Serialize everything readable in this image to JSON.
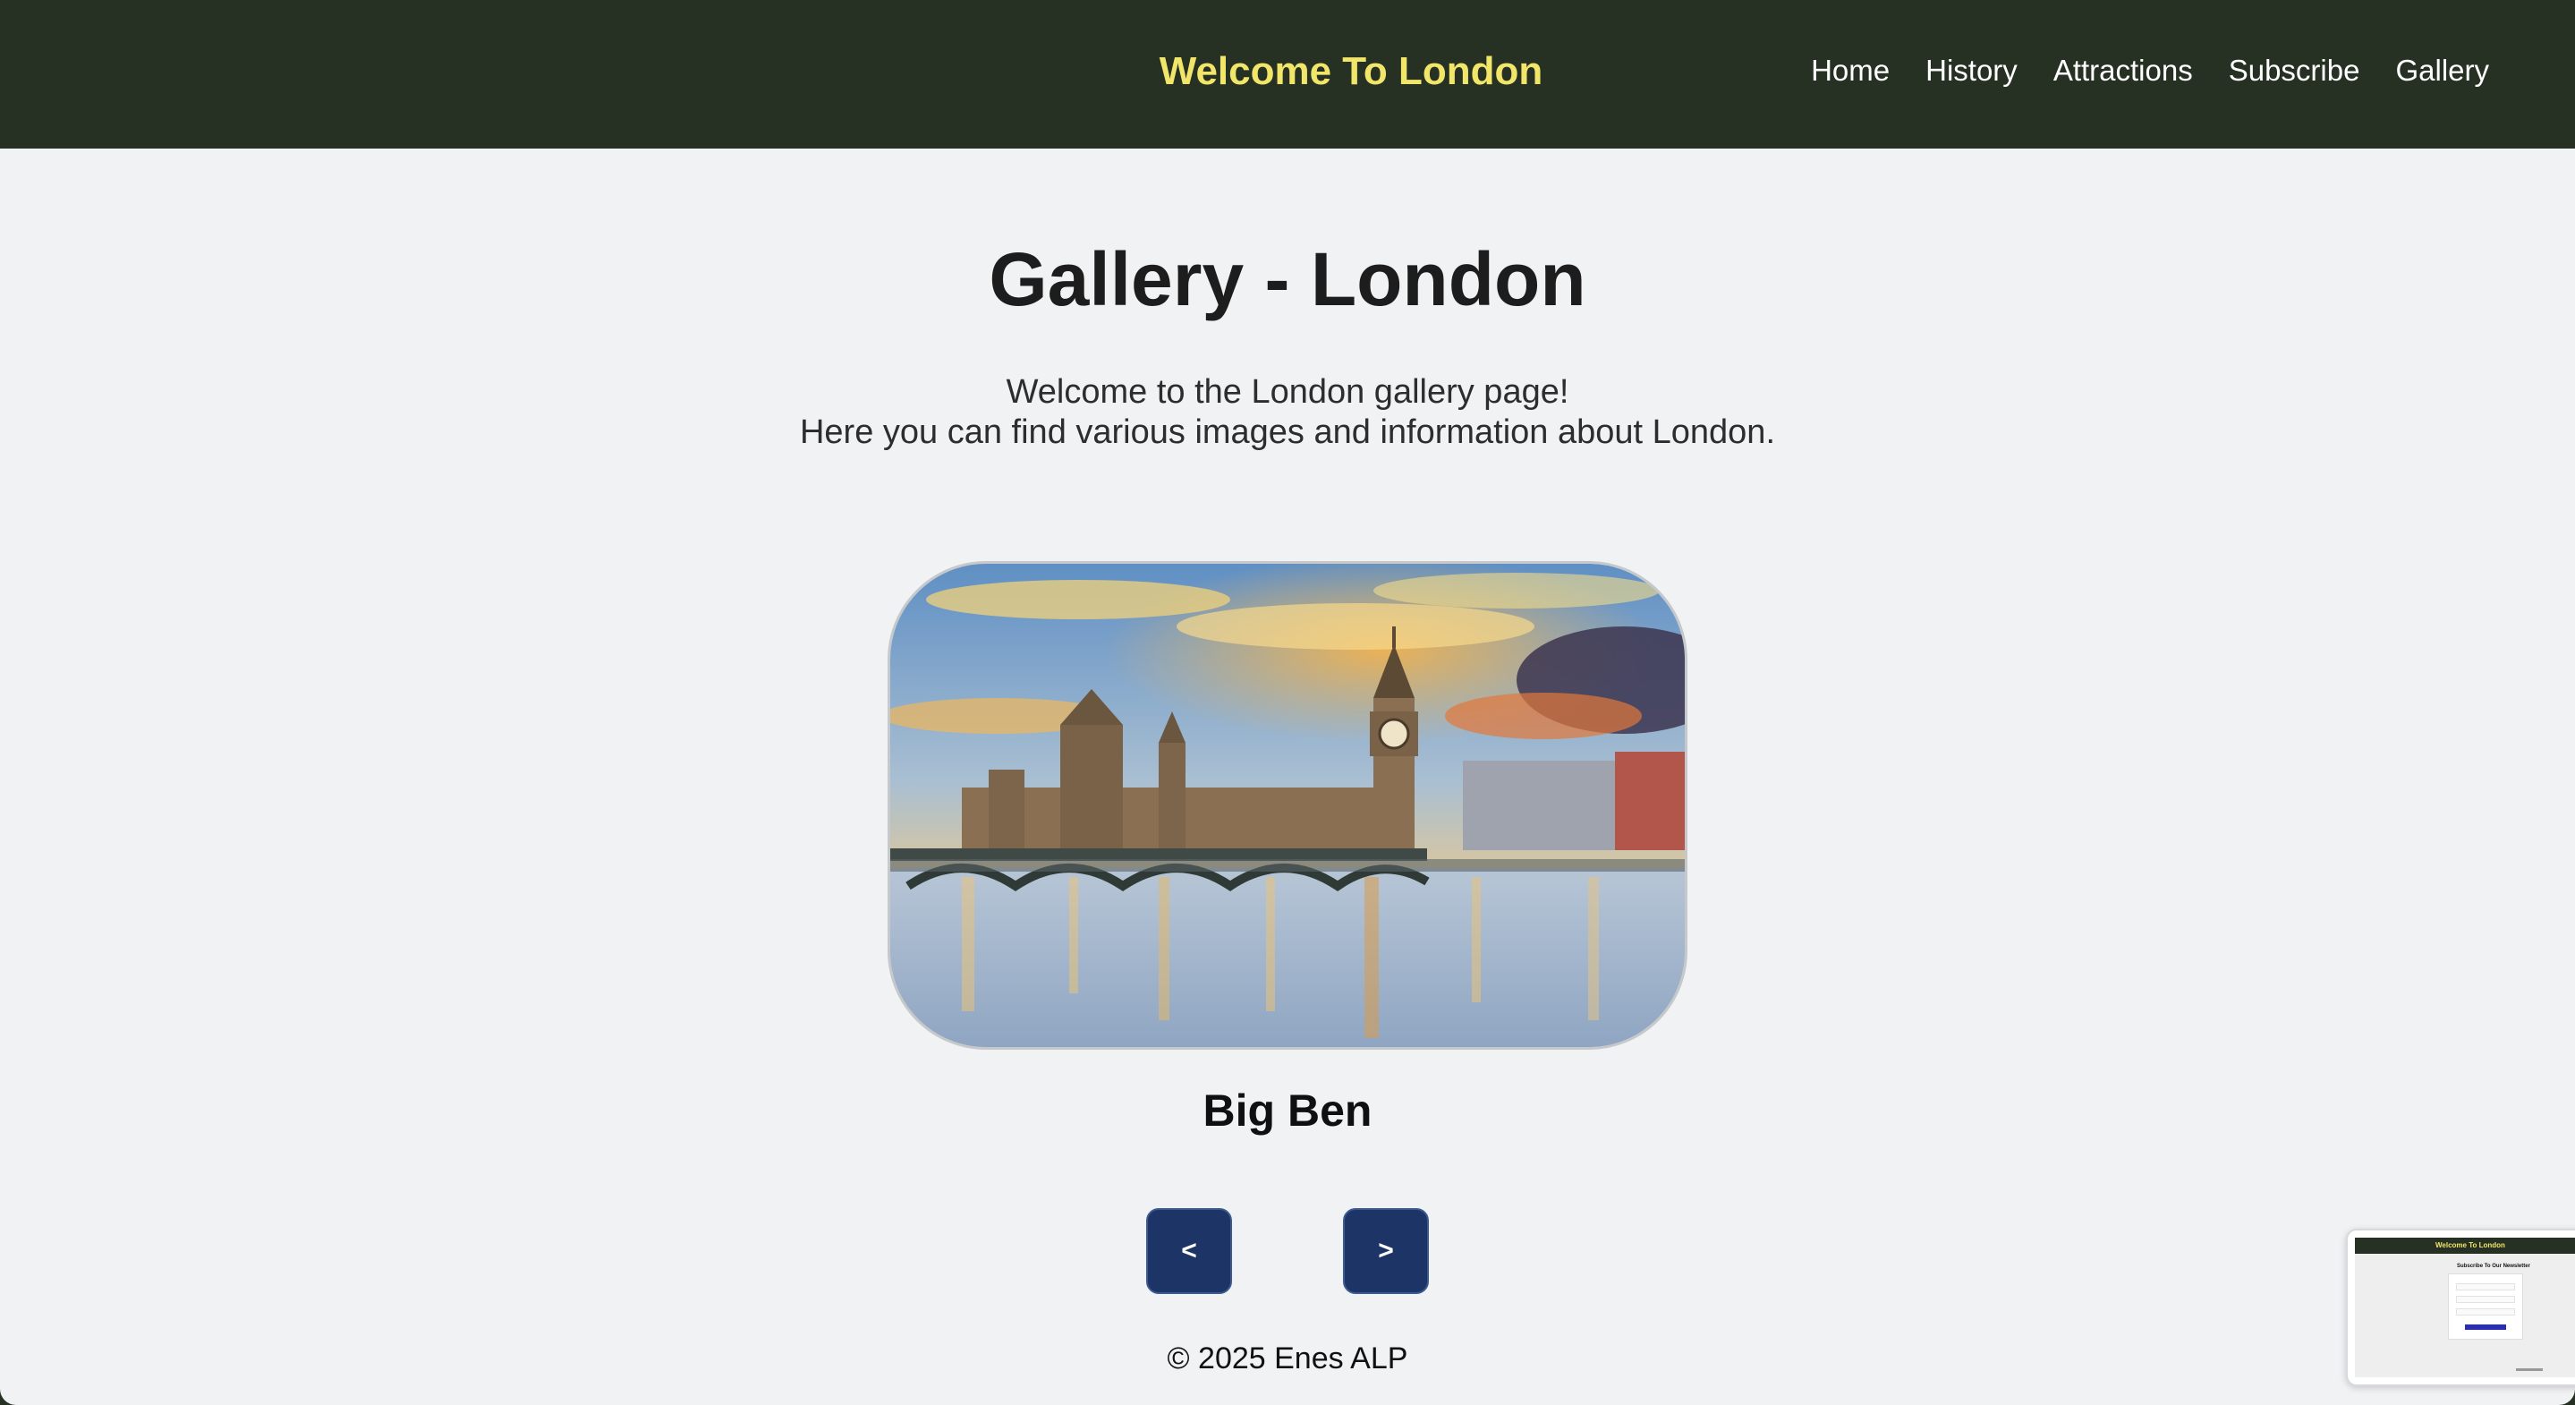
{
  "header": {
    "brand": "Welcome To London",
    "nav": [
      "Home",
      "History",
      "Attractions",
      "Subscribe",
      "Gallery"
    ]
  },
  "main": {
    "title": "Gallery - London",
    "intro_line1": "Welcome to the London gallery page!",
    "intro_line2": "Here you can find various images and information about London.",
    "slide": {
      "image_icon": "westminster-photo",
      "caption": "Big Ben"
    },
    "prev_label": "<",
    "next_label": ">"
  },
  "footer": {
    "text": "© 2025 Enes ALP"
  },
  "preview": {
    "brand": "Welcome To London",
    "heading": "Subscribe To Our Newsletter"
  },
  "colors": {
    "header_bg": "#263123",
    "brand": "#f1e56a",
    "page_bg": "#f1f2f4",
    "button_bg": "#1c3466"
  }
}
